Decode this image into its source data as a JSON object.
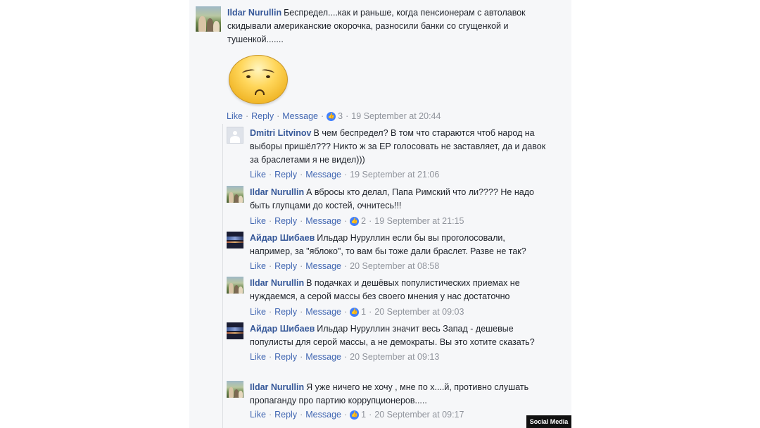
{
  "comments": [
    {
      "author": "Ildar Nurullin",
      "text": "Беспредел....как и раньше, когда пенсионерам с автолавок скидывали американские окорочка, разносили банки со сгущенкой и тушенкой.......",
      "actions": {
        "like": "Like",
        "reply": "Reply",
        "message": "Message"
      },
      "likes": "3",
      "time": "19 September at 20:44"
    }
  ],
  "replies": [
    {
      "author": "Dmitri Litvinov",
      "text": "В чем беспредел? В том что стараются чтоб народ на выборы пришёл??? Никто ж за ЕР голосовать не заставляет, да и давок за браслетами я не видел)))",
      "actions": {
        "like": "Like",
        "reply": "Reply",
        "message": "Message"
      },
      "time": "19 September at 21:06"
    },
    {
      "author": "Ildar Nurullin",
      "text": "А вбросы кто делал, Папа Римский что ли???? Не надо быть глупцами до костей, очнитесь!!!",
      "actions": {
        "like": "Like",
        "reply": "Reply",
        "message": "Message"
      },
      "likes": "2",
      "time": "19 September at 21:15"
    },
    {
      "author": "Айдар Шибаев",
      "text": "Ильдар Нуруллин если бы вы проголосовали, например, за \"яблоко\", то вам бы тоже дали браслет. Разве не так?",
      "actions": {
        "like": "Like",
        "reply": "Reply",
        "message": "Message"
      },
      "time": "20 September at 08:58"
    },
    {
      "author": "Ildar Nurullin",
      "text": "В подачках и дешёвых популистических приемах не нуждаемся, а серой массы без своего мнения у нас достаточно",
      "actions": {
        "like": "Like",
        "reply": "Reply",
        "message": "Message"
      },
      "likes": "1",
      "time": "20 September at 09:03"
    },
    {
      "author": "Айдар Шибаев",
      "text": "Ильдар Нуруллин значит весь Запад - дешевые популисты для серой массы, а не демократы. Вы это хотите сказать?",
      "actions": {
        "like": "Like",
        "reply": "Reply",
        "message": "Message"
      },
      "time": "20 September at 09:13"
    },
    {
      "author": "Ildar Nurullin",
      "text": "Я уже ничего не хочу , мне по х....й, противно слушать пропаганду про партию коррупционеров.....",
      "actions": {
        "like": "Like",
        "reply": "Reply",
        "message": "Message"
      },
      "likes": "1",
      "time": "20 September at 09:17"
    }
  ],
  "sticker": {
    "icon": "sad-face-sticker-icon"
  },
  "like_icon": "thumbs-up-icon",
  "source_badge": "Social Media",
  "colors": {
    "name": "#365899",
    "link": "#4267b2",
    "meta": "#90949c",
    "like_badge": "#4080ff",
    "panel": "#f6f7f9"
  }
}
